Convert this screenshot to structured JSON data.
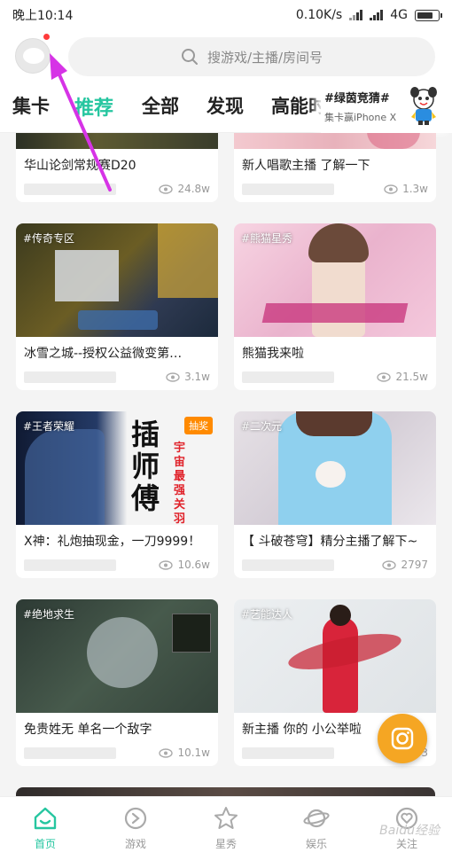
{
  "status_bar": {
    "time": "晚上10:14",
    "network_speed": "0.10K/s",
    "network_type": "4G"
  },
  "search": {
    "placeholder": "搜游戏/主播/房间号"
  },
  "tabs": [
    {
      "label": "集卡"
    },
    {
      "label": "推荐",
      "active": true
    },
    {
      "label": "全部"
    },
    {
      "label": "发现"
    },
    {
      "label": "高能时"
    }
  ],
  "promo": {
    "hashtag": "#绿茵竞猜#",
    "subtitle": "集卡赢iPhone X"
  },
  "cards": [
    {
      "tag": "",
      "title": "华山论剑常规赛D20",
      "views": "24.8w"
    },
    {
      "tag": "",
      "title": "新人唱歌主播 了解一下",
      "views": "1.3w"
    },
    {
      "tag": "#传奇专区",
      "title": "冰雪之城--授权公益微变第…",
      "views": "3.1w"
    },
    {
      "tag": "#熊猫星秀",
      "title": "熊猫我来啦",
      "views": "21.5w"
    },
    {
      "tag": "#王者荣耀",
      "title": "X神：礼炮抽现金，一刀9999！",
      "views": "10.6w",
      "badge": "抽奖",
      "overlay_text": "插师傅",
      "overlay_sub": "宇宙最强关羽"
    },
    {
      "tag": "#二次元",
      "title": "【 斗破苍穹】精分主播了解下~",
      "views": "2797"
    },
    {
      "tag": "#绝地求生",
      "title": "免贵姓无 单名一个敌字",
      "views": "10.1w"
    },
    {
      "tag": "#艺能达人",
      "title": "新主播  你的 小公举啦",
      "views": "3"
    }
  ],
  "bottom_nav": [
    {
      "label": "首页",
      "icon": "home-icon",
      "active": true
    },
    {
      "label": "游戏",
      "icon": "gamepad-icon"
    },
    {
      "label": "星秀",
      "icon": "star-icon"
    },
    {
      "label": "娱乐",
      "icon": "planet-icon"
    },
    {
      "label": "关注",
      "icon": "heart-icon"
    }
  ],
  "watermark": "Baidu经验",
  "colors": {
    "accent": "#26c6a0",
    "annotation_arrow": "#d633e6",
    "camera_fab": "#f5a623"
  }
}
